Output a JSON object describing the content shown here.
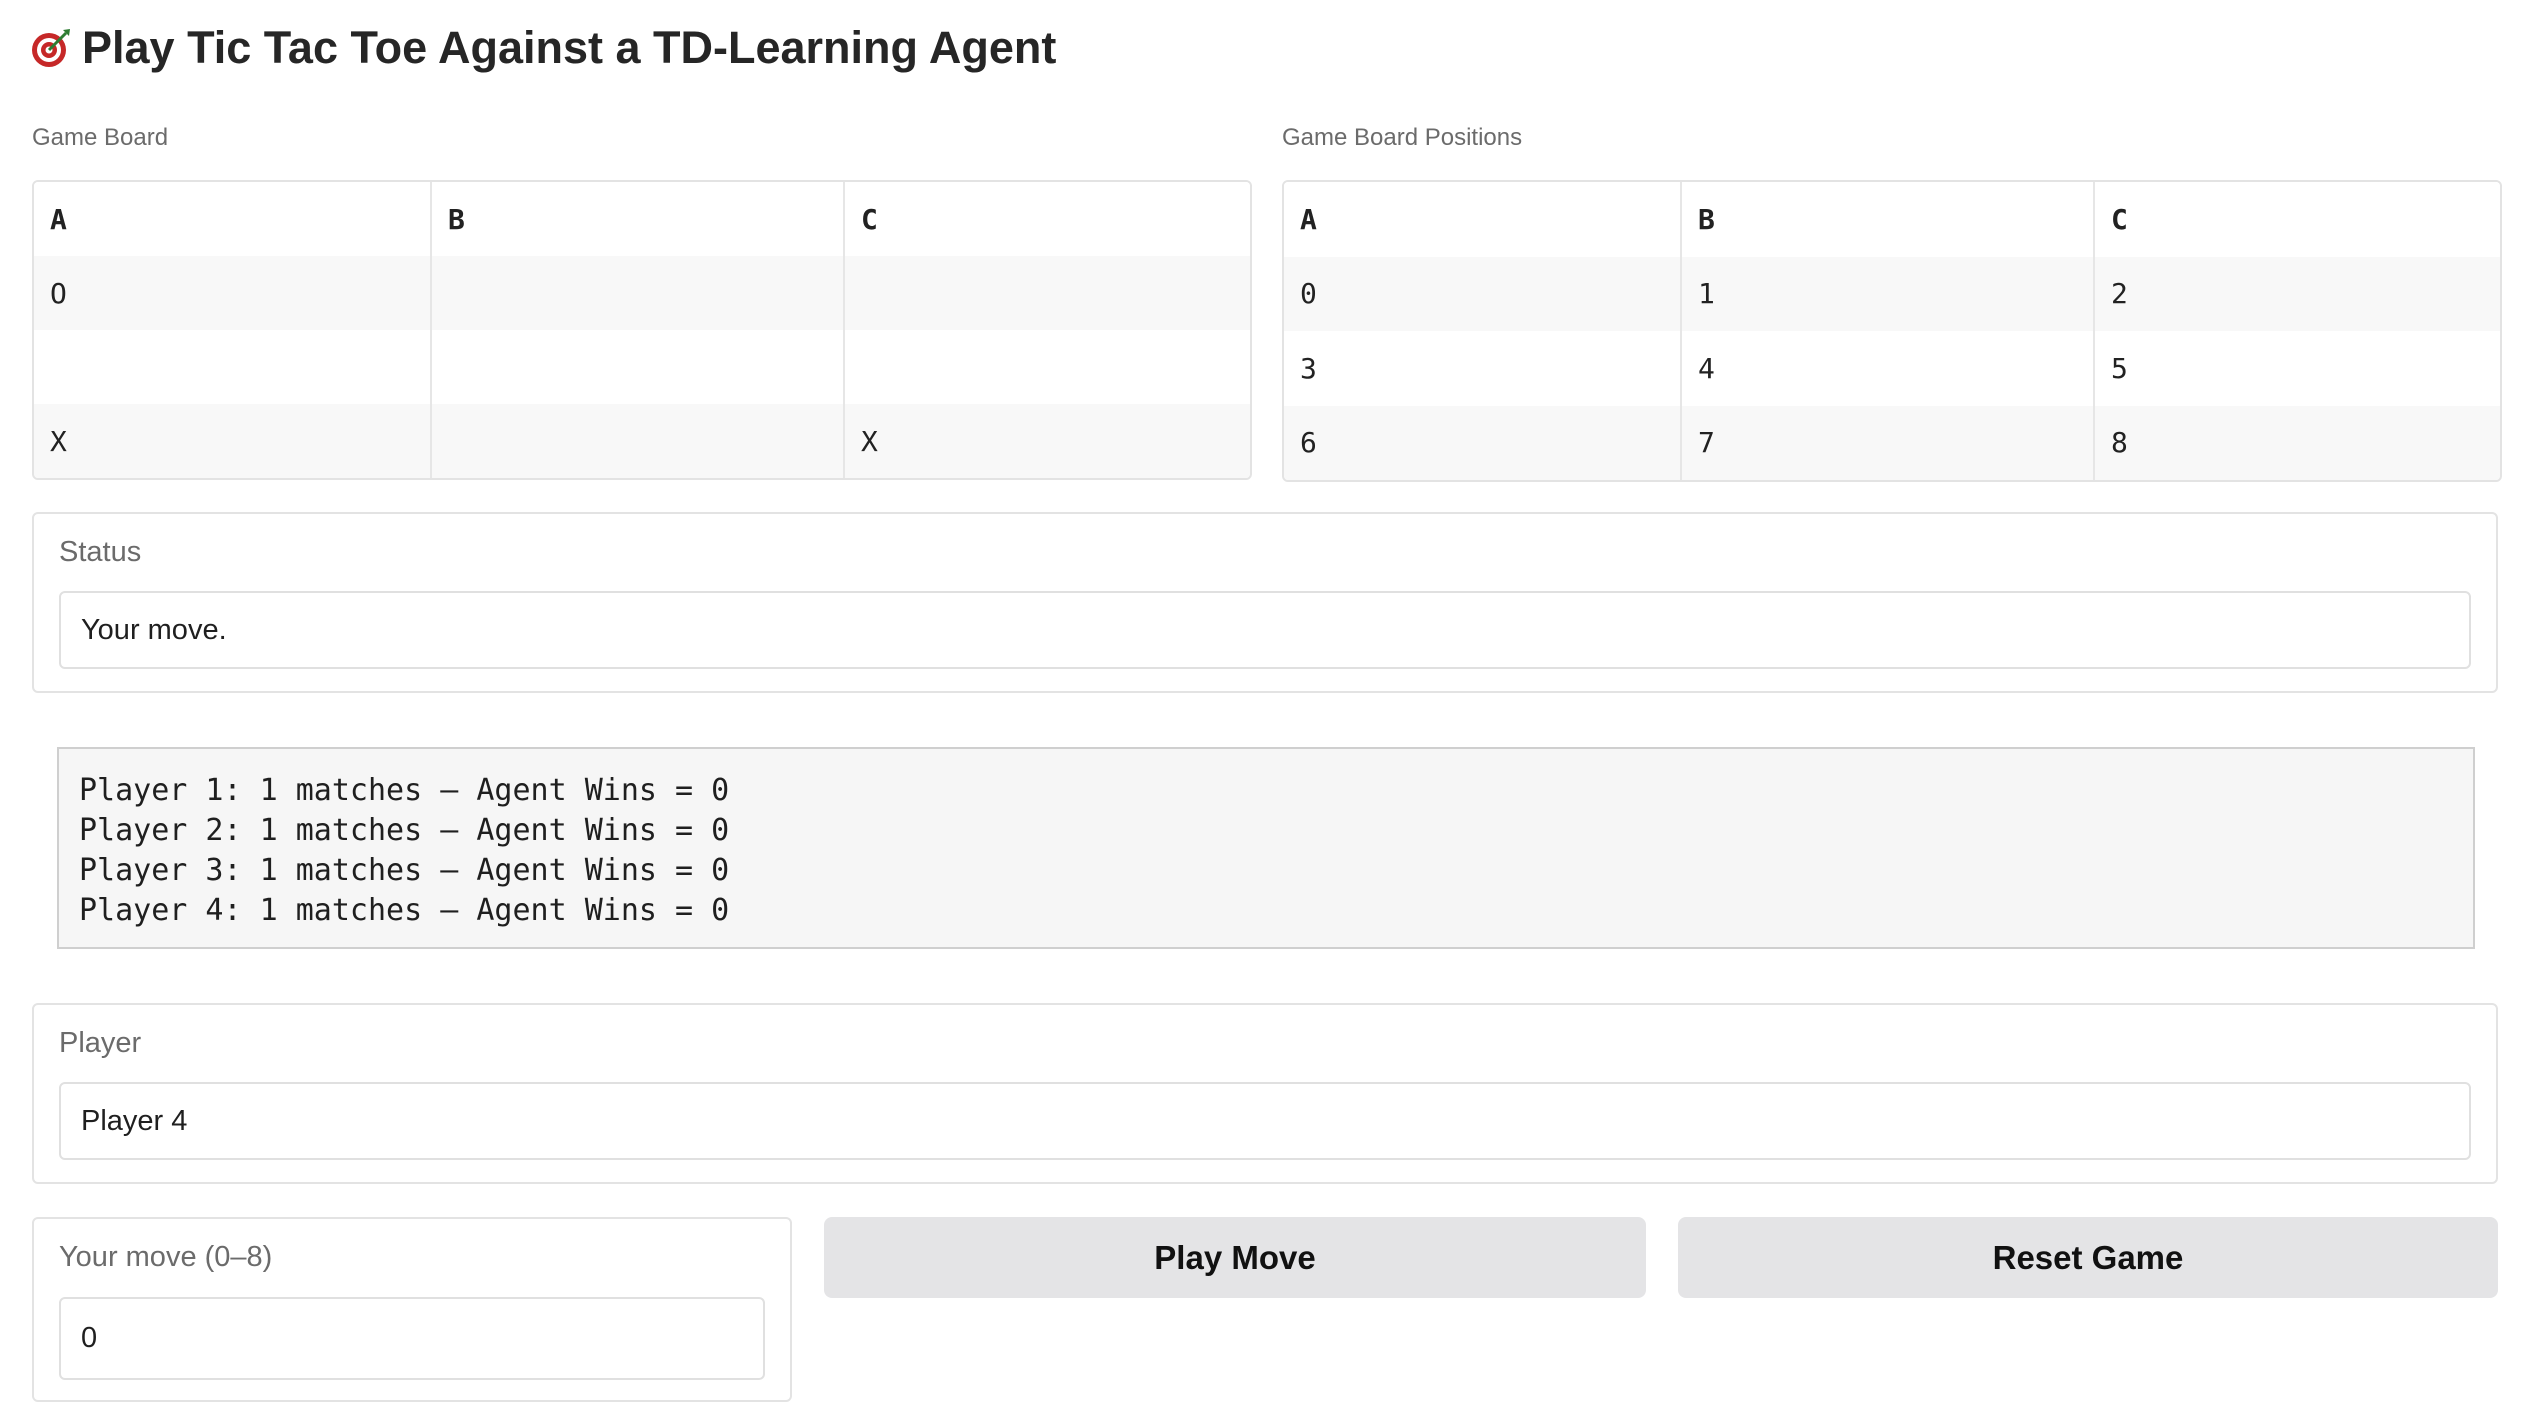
{
  "header": {
    "title": "Play Tic Tac Toe Against a TD-Learning Agent",
    "icon": "dart-target-icon"
  },
  "game_board": {
    "label": "Game Board",
    "columns": [
      "A",
      "B",
      "C"
    ],
    "rows": [
      [
        "O",
        "",
        ""
      ],
      [
        "",
        "",
        ""
      ],
      [
        "X",
        "",
        "X"
      ]
    ]
  },
  "positions_board": {
    "label": "Game Board Positions",
    "columns": [
      "A",
      "B",
      "C"
    ],
    "rows": [
      [
        "0",
        "1",
        "2"
      ],
      [
        "3",
        "4",
        "5"
      ],
      [
        "6",
        "7",
        "8"
      ]
    ]
  },
  "status": {
    "label": "Status",
    "value": "Your move."
  },
  "log": {
    "lines": [
      "Player 1: 1 matches — Agent Wins = 0",
      "Player 2: 1 matches — Agent Wins = 0",
      "Player 3: 1 matches — Agent Wins = 0",
      "Player 4: 1 matches — Agent Wins = 0"
    ]
  },
  "player": {
    "label": "Player",
    "value": "Player 4"
  },
  "move": {
    "label": "Your move (0–8)",
    "value": "0"
  },
  "buttons": {
    "play": "Play Move",
    "reset": "Reset Game"
  }
}
